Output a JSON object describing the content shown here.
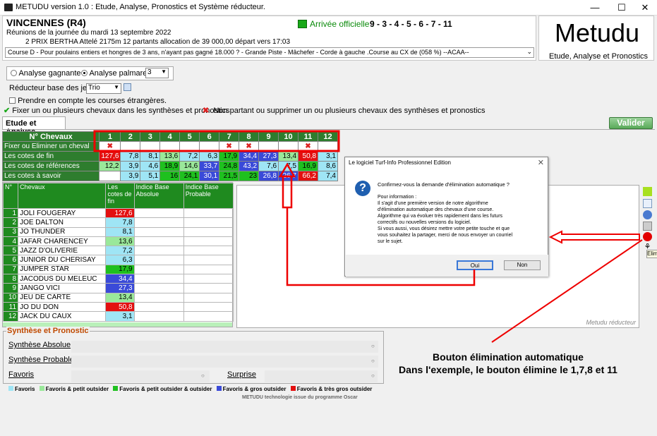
{
  "window": {
    "title": "METUDU version 1.0  : Etude, Analyse,  Pronostics et Système réducteur."
  },
  "header": {
    "hippodrome": "VINCENNES (R4)",
    "reunion": "Réunions de la journée du mardi 13 septembre 2022",
    "prix": "2 PRIX BERTHA Attelé 2175m 12 partants allocation de 39 000,00 départ vers 17:03",
    "course": "Course D - Pour poulains entiers et hongres de 3 ans, n'ayant pas gagné 18.000 ? - Grande Piste - Mâchefer - Corde à gauche .Course au CX de (058 %)  --ACAA--",
    "arrivee_label": "Arrivée officielle :",
    "arrivee": "9 - 3 - 4 - 5 - 6 - 7 - 11"
  },
  "logo": {
    "name": "Metudu",
    "tagline": "Etude, Analyse et Pronostics"
  },
  "options": {
    "analyse_gagnante": "Analyse gagnante",
    "analyse_palmares": "Analyse palmares",
    "palmares_value": "3",
    "reducteur_label": "Réducteur base des jeux :",
    "reducteur_value": "Trio",
    "etrangeres": "Prendre en compte les courses étrangères.",
    "fixer": "Fixer un ou plusieurs chevaux dans les synthèses et pronostics",
    "non_partant": "Non partant ou supprimer un ou plusieurs chevaux des synthèses et pronostics"
  },
  "tabs": {
    "active": "Etude et Analyse",
    "valider": "Valider"
  },
  "grid": {
    "header": "N° Chevaux",
    "numbers": [
      "1",
      "2",
      "3",
      "4",
      "5",
      "6",
      "7",
      "8",
      "9",
      "10",
      "11",
      "12"
    ],
    "fixer_label": "Fixer ou Eliminer un cheval",
    "eliminated": [
      1,
      7,
      8,
      11
    ],
    "rows": [
      {
        "label": "Les cotes de fin",
        "values": [
          "127,6",
          "7,8",
          "8,1",
          "13,6",
          "7,2",
          "6,3",
          "17,9",
          "34,4",
          "27,3",
          "13,4",
          "50,8",
          "3,1"
        ]
      },
      {
        "label": "Les cotes de références",
        "values": [
          "12,2",
          "3,9",
          "4,6",
          "18,9",
          "14,6",
          "33,7",
          "24,8",
          "43,2",
          "7,6",
          "7,5",
          "16,9",
          "8,6"
        ]
      },
      {
        "label": "Les cotes à savoir",
        "values": [
          "",
          "3,9",
          "5,1",
          "16",
          "24,1",
          "30,1",
          "21,5",
          "23",
          "26,8",
          "26,7",
          "66,2",
          "7,4"
        ]
      }
    ]
  },
  "horses": {
    "headers": {
      "n": "N°",
      "name": "Chevaux",
      "cote": "Les cotes de fin",
      "ba": "Indice Base Absolue",
      "bp": "Indice Base Probable"
    },
    "rows": [
      {
        "n": "1",
        "name": "JOLI FOUGERAY",
        "cote": "127,6"
      },
      {
        "n": "2",
        "name": "JOE DALTON",
        "cote": "7,8"
      },
      {
        "n": "3",
        "name": "JO THUNDER",
        "cote": "8,1"
      },
      {
        "n": "4",
        "name": "JAFAR CHARENCEY",
        "cote": "13,6"
      },
      {
        "n": "5",
        "name": "JAZZ D'OLIVERIE",
        "cote": "7,2"
      },
      {
        "n": "6",
        "name": "JUNIOR DU CHERISAY",
        "cote": "6,3"
      },
      {
        "n": "7",
        "name": "JUMPER STAR",
        "cote": "17,9"
      },
      {
        "n": "8",
        "name": "JACODUS DU MELEUC",
        "cote": "34,4"
      },
      {
        "n": "9",
        "name": "JANGO VICI",
        "cote": "27,3"
      },
      {
        "n": "10",
        "name": "JEU DE CARTE",
        "cote": "13,4"
      },
      {
        "n": "11",
        "name": "JO DU DON",
        "cote": "50,8"
      },
      {
        "n": "12",
        "name": "JACK DU CAUX",
        "cote": "3,1"
      }
    ]
  },
  "panel": {
    "caption": "Metudu réducteur",
    "tooltip": "Elim"
  },
  "dialog": {
    "title": "Le logiciel Turf-Info Professionnel Edition",
    "question": "Confirmez-vous la demande d'élimination automatique ?",
    "info_title": "Pour information :",
    "lines": [
      "Il s'agit d'une première version de notre algorithme",
      "d'élimination automatique des chevaux d'une course.",
      "Algorithme qui va évoluer très rapidement dans les futurs",
      "correctifs ou nouvelles versions du logiciel.",
      "Si vous aussi, vous désirez mettre votre petite touche et que",
      "vous souhaitez la partager, merci de nous envoyer un courriel",
      "sur le sujet."
    ],
    "oui": "Oui",
    "non": "Non"
  },
  "synthese": {
    "legend": "Synthèse et Pronostic",
    "absolue": "Synthèse Absolue",
    "probable": "Synthèse Probable",
    "favoris": "Favoris",
    "surprise": "Surprise"
  },
  "legend": [
    {
      "label": "Favoris",
      "color": "#9fe5f5"
    },
    {
      "label": "Favoris & petit outsider",
      "color": "#9ae89a"
    },
    {
      "label": "Favoris & petit outsider & outsider",
      "color": "#1fc01f"
    },
    {
      "label": "Favoris & gros outsider",
      "color": "#3a4ad8"
    },
    {
      "label": "Favoris & très gros outsider",
      "color": "#e31010"
    }
  ],
  "tech": "METUDU technologie issue du programme Oscar",
  "annotation": {
    "line1": "Bouton élimination automatique",
    "line2": "Dans l'exemple, le bouton élimine le 1,7,8 et 11"
  }
}
